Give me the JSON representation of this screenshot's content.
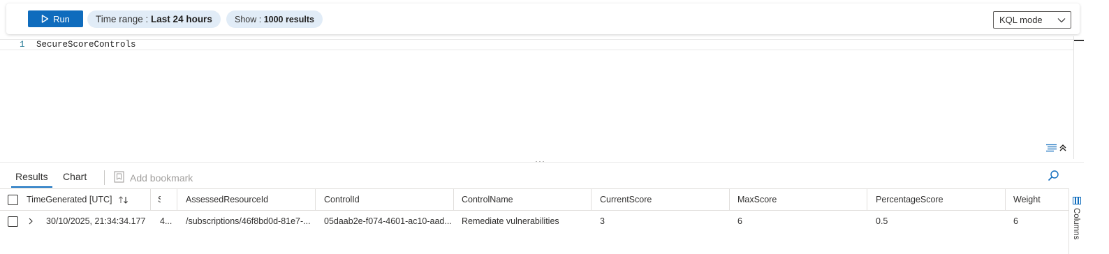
{
  "toolbar": {
    "run_label": "Run",
    "time_range_label": "Time range :",
    "time_range_value": "Last 24 hours",
    "show_label": "Show :",
    "show_value": "1000 results",
    "mode_select": "KQL mode"
  },
  "editor": {
    "line_number": "1",
    "query": "SecureScoreControls",
    "splitter": "···"
  },
  "results_bar": {
    "tabs": [
      "Results",
      "Chart"
    ],
    "active_tab": "Results",
    "bookmark_label": "Add bookmark"
  },
  "grid": {
    "columns": [
      "TimeGenerated [UTC]",
      "S",
      "AssessedResourceId",
      "ControlId",
      "ControlName",
      "CurrentScore",
      "MaxScore",
      "PercentageScore",
      "Weight"
    ],
    "rows": [
      [
        "30/10/2025, 21:34:34.177",
        "4...",
        "/subscriptions/46f8bd0d-81e7-...",
        "05daab2e-f074-4601-ac10-aad...",
        "Remediate vulnerabilities",
        "3",
        "6",
        "0.5",
        "6"
      ]
    ],
    "side_panel_label": "Columns"
  },
  "colors": {
    "accent": "#0f6cbd",
    "pill_bg": "#e1ecf7"
  },
  "icons": [
    "play-icon",
    "chevron-down-icon",
    "format-icon",
    "collapse-up-icon",
    "bookmark-icon",
    "search-icon",
    "sort-icon",
    "expand-row-icon",
    "columns-icon"
  ]
}
